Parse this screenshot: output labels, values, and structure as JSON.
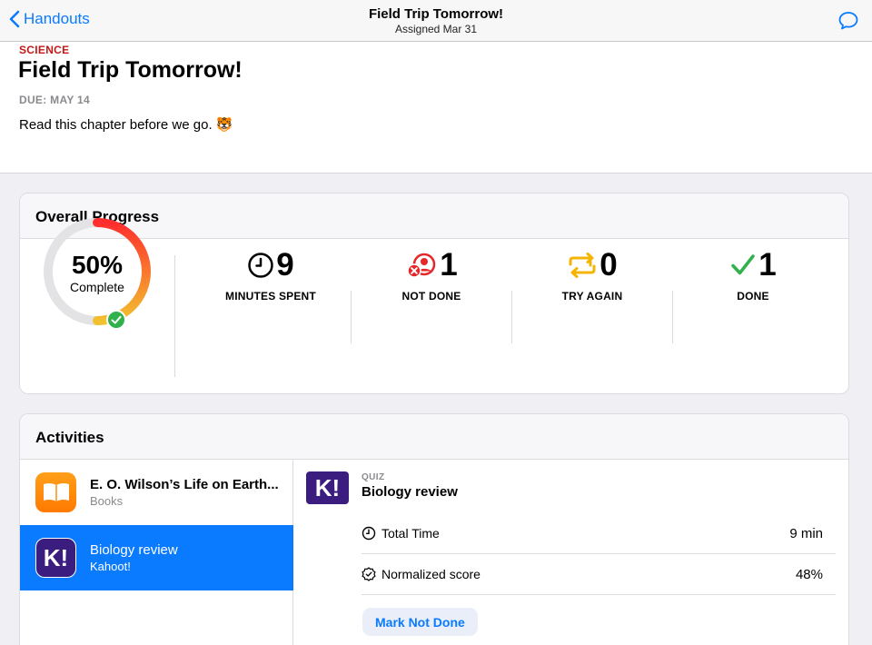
{
  "navbar": {
    "back_label": "Handouts",
    "title": "Field Trip Tomorrow!",
    "subtitle": "Assigned Mar 31"
  },
  "assignment": {
    "subject": "SCIENCE",
    "title": "Field Trip Tomorrow!",
    "due": "DUE: MAY 14",
    "instructions": "Read this chapter before we go. 🐯"
  },
  "progress": {
    "header": "Overall Progress",
    "percent_text": "50%",
    "percent_value": 0.5,
    "complete_label": "Complete",
    "stats": [
      {
        "value": "9",
        "label": "MINUTES SPENT",
        "icon": "clock-icon"
      },
      {
        "value": "1",
        "label": "NOT DONE",
        "icon": "not-done-icon"
      },
      {
        "value": "0",
        "label": "TRY AGAIN",
        "icon": "try-again-icon"
      },
      {
        "value": "1",
        "label": "DONE",
        "icon": "checkmark-icon"
      }
    ]
  },
  "activities": {
    "header": "Activities",
    "items": [
      {
        "title": "E. O. Wilson’s Life on Earth...",
        "source": "Books",
        "icon": "books-app-icon"
      },
      {
        "title": "Biology review",
        "source": "Kahoot!",
        "icon": "kahoot-app-icon"
      }
    ],
    "detail": {
      "type": "QUIZ",
      "title": "Biology review",
      "rows": [
        {
          "label": "Total Time",
          "value": "9 min",
          "icon": "clock-icon"
        },
        {
          "label": "Normalized score",
          "value": "48%",
          "icon": "score-badge-icon"
        }
      ],
      "action_label": "Mark Not Done"
    }
  },
  "colors": {
    "accent": "#0a7aff",
    "subject": "#c21818",
    "ring_start": "#ff2d2d",
    "ring_end": "#f2c12e",
    "done": "#30b14c",
    "not_done": "#e5262b",
    "try_again": "#f4b400",
    "kahoot": "#3a1d7e"
  }
}
